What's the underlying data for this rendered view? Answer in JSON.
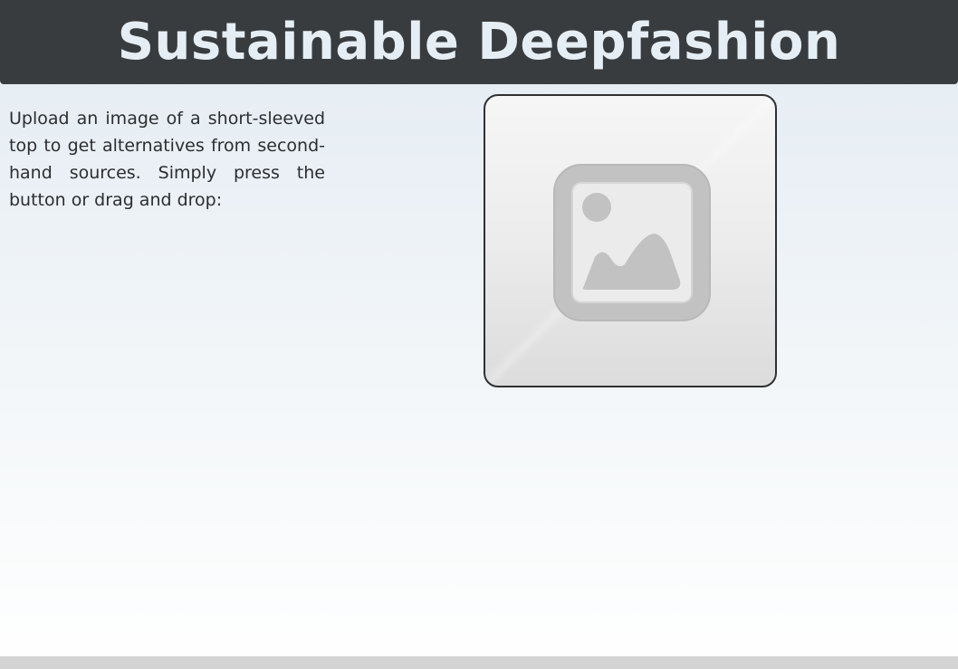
{
  "header": {
    "title": "Sustainable Deepfashion"
  },
  "main": {
    "description": "Upload an image of a short-sleeved top to get alternatives from second-hand sources. Simply press the button or drag and drop:"
  },
  "uploader": {
    "icon": "image-placeholder-icon"
  },
  "colors": {
    "header_bg": "#393c3e",
    "header_text": "#e6eef5",
    "body_text": "#2b2e30",
    "upload_border": "#2e3133"
  }
}
